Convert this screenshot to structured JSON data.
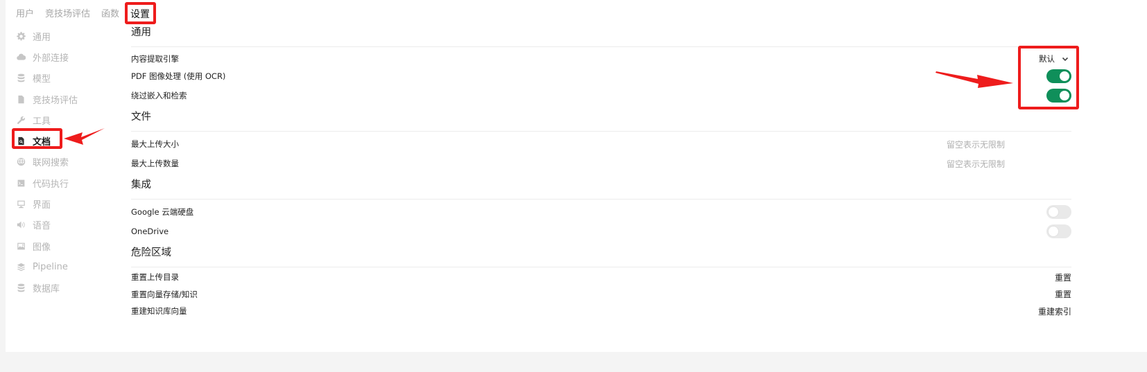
{
  "top_tabs": [
    "用户",
    "竞技场评估",
    "函数",
    "设置"
  ],
  "sidebar": {
    "items": [
      {
        "label": "通用",
        "icon": "gear-icon"
      },
      {
        "label": "外部连接",
        "icon": "cloud-icon"
      },
      {
        "label": "模型",
        "icon": "database-icon"
      },
      {
        "label": "竞技场评估",
        "icon": "document-icon"
      },
      {
        "label": "工具",
        "icon": "wrench-icon"
      },
      {
        "label": "文档",
        "icon": "document-search-icon"
      },
      {
        "label": "联网搜索",
        "icon": "globe-icon"
      },
      {
        "label": "代码执行",
        "icon": "terminal-icon"
      },
      {
        "label": "界面",
        "icon": "monitor-icon"
      },
      {
        "label": "语音",
        "icon": "speaker-icon"
      },
      {
        "label": "图像",
        "icon": "image-icon"
      },
      {
        "label": "Pipeline",
        "icon": "layers-icon"
      },
      {
        "label": "数据库",
        "icon": "database-icon"
      }
    ]
  },
  "sections": {
    "general": {
      "title": "通用",
      "content_engine_label": "内容提取引擎",
      "content_engine_value": "默认",
      "pdf_ocr_label": "PDF 图像处理 (使用 OCR)",
      "bypass_label": "绕过嵌入和检索"
    },
    "files": {
      "title": "文件",
      "max_size_label": "最大上传大小",
      "max_size_placeholder": "留空表示无限制",
      "max_count_label": "最大上传数量",
      "max_count_placeholder": "留空表示无限制"
    },
    "integrations": {
      "title": "集成",
      "gdrive_label": "Google 云端硬盘",
      "onedrive_label": "OneDrive"
    },
    "danger": {
      "title": "危险区域",
      "reset_upload_label": "重置上传目录",
      "reset_upload_action": "重置",
      "reset_vector_label": "重置向量存储/知识",
      "reset_vector_action": "重置",
      "reindex_label": "重建知识库向量",
      "reindex_action": "重建索引"
    }
  },
  "colors": {
    "toggle_on": "#0f8f5a",
    "toggle_off": "#e9e9e9",
    "annotation": "#ee1c1c"
  }
}
